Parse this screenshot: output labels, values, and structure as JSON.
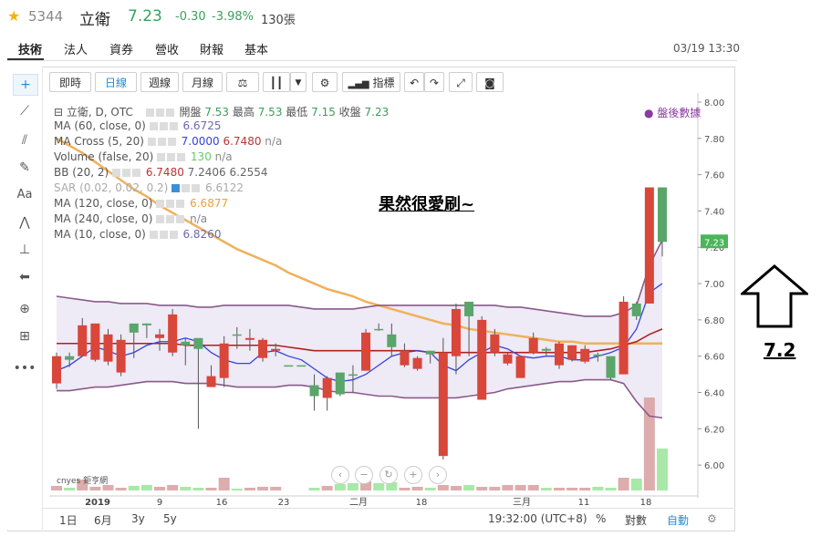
{
  "quote": {
    "star_icon": "star-icon",
    "code": "5344",
    "name": "立衛",
    "price": "7.23",
    "change": "-0.30",
    "change_pct": "-3.98%",
    "volume": "130張",
    "accent_up": "#d9534f",
    "accent_down": "#3a9f5a"
  },
  "tabs": [
    "技術",
    "法人",
    "資券",
    "營收",
    "財報",
    "基本"
  ],
  "timestamp": "03/19 13:30",
  "toolbar": {
    "buttons": [
      "即時",
      "日線",
      "週線",
      "月線"
    ],
    "active": "日線",
    "indicators_label": "指標"
  },
  "legend": {
    "main": "立衛, D, OTC",
    "ohlc_labels": [
      "開盤",
      "最高",
      "最低",
      "收盤"
    ],
    "ohlc_values": [
      "7.53",
      "7.53",
      "7.15",
      "7.23"
    ],
    "after_hours": "盤後數據",
    "rows": [
      {
        "name": "MA (60, close, 0)",
        "values": [
          "6.6725"
        ]
      },
      {
        "name": "MA Cross (5, 20)",
        "values": [
          "7.0000",
          "6.7480",
          "n/a"
        ]
      },
      {
        "name": "Volume (false, 20)",
        "values": [
          "130",
          "n/a"
        ]
      },
      {
        "name": "BB (20, 2)",
        "values": [
          "6.7480",
          "7.2406",
          "6.2554"
        ]
      },
      {
        "name": "SAR (0.02, 0.02, 0.2)",
        "values": [
          "6.6122"
        ]
      },
      {
        "name": "MA (120, close, 0)",
        "values": [
          "6.6877"
        ]
      },
      {
        "name": "MA (240, close, 0)",
        "values": [
          "n/a"
        ]
      },
      {
        "name": "MA (10, close, 0)",
        "values": [
          "6.8260"
        ]
      }
    ]
  },
  "annotation_text": "果然很愛刷~",
  "arrow_label": "7.2",
  "watermark": "cnyes 鉅亨網",
  "bottom": {
    "ranges": [
      "1日",
      "6月",
      "3y",
      "5y"
    ],
    "time": "19:32:00 (UTC+8)",
    "pct": "%",
    "log": "對數",
    "auto": "自動"
  },
  "chart_data": {
    "type": "candlestick",
    "y_ticks": [
      "8.00",
      "7.80",
      "7.60",
      "7.40",
      "7.20",
      "7.00",
      "6.80",
      "6.60",
      "6.40",
      "6.20",
      "6.00"
    ],
    "ylim": [
      5.85,
      8.02
    ],
    "last_price_label": "7.23",
    "x_ticks": [
      "2019",
      "9",
      "16",
      "23",
      "二月",
      "18",
      "三月",
      "11",
      "18"
    ],
    "candles": [
      {
        "o": 6.6,
        "h": 6.62,
        "l": 6.42,
        "c": 6.45
      },
      {
        "o": 6.58,
        "h": 6.62,
        "l": 6.54,
        "c": 6.6
      },
      {
        "o": 6.77,
        "h": 6.81,
        "l": 6.6,
        "c": 6.6
      },
      {
        "o": 6.78,
        "h": 6.78,
        "l": 6.57,
        "c": 6.58
      },
      {
        "o": 6.72,
        "h": 6.75,
        "l": 6.55,
        "c": 6.57
      },
      {
        "o": 6.69,
        "h": 6.72,
        "l": 6.49,
        "c": 6.51
      },
      {
        "o": 6.73,
        "h": 6.77,
        "l": 6.59,
        "c": 6.78
      },
      {
        "o": 6.77,
        "h": 6.78,
        "l": 6.7,
        "c": 6.78
      },
      {
        "o": 6.72,
        "h": 6.75,
        "l": 6.63,
        "c": 6.7
      },
      {
        "o": 6.83,
        "h": 6.86,
        "l": 6.6,
        "c": 6.62
      },
      {
        "o": 6.66,
        "h": 6.7,
        "l": 6.55,
        "c": 6.68
      },
      {
        "o": 6.64,
        "h": 6.68,
        "l": 6.2,
        "c": 6.7
      },
      {
        "o": 6.49,
        "h": 6.55,
        "l": 6.43,
        "c": 6.43
      },
      {
        "o": 6.67,
        "h": 6.71,
        "l": 6.43,
        "c": 6.48
      },
      {
        "o": 6.72,
        "h": 6.76,
        "l": 6.64,
        "c": 6.72
      },
      {
        "o": 6.7,
        "h": 6.75,
        "l": 6.63,
        "c": 6.69
      },
      {
        "o": 6.69,
        "h": 6.7,
        "l": 6.57,
        "c": 6.59
      },
      {
        "o": 6.64,
        "h": 6.67,
        "l": 6.6,
        "c": 6.63
      },
      {
        "o": 6.55,
        "h": 6.55,
        "l": 6.55,
        "c": 6.55
      },
      {
        "o": 6.55,
        "h": 6.55,
        "l": 6.55,
        "c": 6.55
      },
      {
        "o": 6.38,
        "h": 6.5,
        "l": 6.3,
        "c": 6.44
      },
      {
        "o": 6.48,
        "h": 6.49,
        "l": 6.3,
        "c": 6.37
      },
      {
        "o": 6.39,
        "h": 6.5,
        "l": 6.38,
        "c": 6.51
      },
      {
        "o": 6.5,
        "h": 6.55,
        "l": 6.4,
        "c": 6.5
      },
      {
        "o": 6.73,
        "h": 6.75,
        "l": 6.52,
        "c": 6.52
      },
      {
        "o": 6.75,
        "h": 6.78,
        "l": 6.74,
        "c": 6.75
      },
      {
        "o": 6.65,
        "h": 6.78,
        "l": 6.6,
        "c": 6.72
      },
      {
        "o": 6.63,
        "h": 6.67,
        "l": 6.54,
        "c": 6.55
      },
      {
        "o": 6.59,
        "h": 6.6,
        "l": 6.52,
        "c": 6.53
      },
      {
        "o": 6.61,
        "h": 6.63,
        "l": 6.56,
        "c": 6.63
      },
      {
        "o": 6.62,
        "h": 6.7,
        "l": 6.03,
        "c": 6.05
      },
      {
        "o": 6.86,
        "h": 6.89,
        "l": 6.5,
        "c": 6.6
      },
      {
        "o": 6.82,
        "h": 6.9,
        "l": 6.6,
        "c": 6.9
      },
      {
        "o": 6.8,
        "h": 6.82,
        "l": 6.36,
        "c": 6.36
      },
      {
        "o": 6.72,
        "h": 6.75,
        "l": 6.6,
        "c": 6.62
      },
      {
        "o": 6.61,
        "h": 6.62,
        "l": 6.55,
        "c": 6.56
      },
      {
        "o": 6.6,
        "h": 6.6,
        "l": 6.48,
        "c": 6.48
      },
      {
        "o": 6.7,
        "h": 6.73,
        "l": 6.61,
        "c": 6.62
      },
      {
        "o": 6.63,
        "h": 6.65,
        "l": 6.6,
        "c": 6.64
      },
      {
        "o": 6.67,
        "h": 6.68,
        "l": 6.53,
        "c": 6.55
      },
      {
        "o": 6.66,
        "h": 6.66,
        "l": 6.57,
        "c": 6.58
      },
      {
        "o": 6.64,
        "h": 6.66,
        "l": 6.56,
        "c": 6.57
      },
      {
        "o": 6.6,
        "h": 6.62,
        "l": 6.57,
        "c": 6.61
      },
      {
        "o": 6.48,
        "h": 6.52,
        "l": 6.47,
        "c": 6.6
      },
      {
        "o": 6.9,
        "h": 6.93,
        "l": 6.5,
        "c": 6.5
      },
      {
        "o": 6.82,
        "h": 6.9,
        "l": 6.8,
        "c": 6.89
      },
      {
        "o": 7.53,
        "h": 7.53,
        "l": 6.89,
        "c": 6.89
      },
      {
        "o": 7.23,
        "h": 7.53,
        "l": 7.15,
        "c": 7.53
      }
    ],
    "volume": [
      0.5,
      0.3,
      1.2,
      0.4,
      0.6,
      0.3,
      0.5,
      0.6,
      0.4,
      0.6,
      0.4,
      0.3,
      0.3,
      1.4,
      0.2,
      0.3,
      0.4,
      0.4,
      0,
      0,
      0.3,
      0.5,
      0.7,
      0.8,
      1.0,
      0.8,
      0.9,
      0.3,
      0.4,
      0.3,
      0.6,
      0.5,
      0.6,
      0.4,
      0.4,
      0.6,
      0.6,
      0.6,
      0.3,
      0.3,
      0.3,
      0.3,
      0.4,
      0.3,
      1.4,
      1.3,
      10.2,
      4.6
    ],
    "bb_upper": [
      6.93,
      6.92,
      6.91,
      6.9,
      6.9,
      6.89,
      6.89,
      6.89,
      6.88,
      6.88,
      6.88,
      6.87,
      6.87,
      6.88,
      6.88,
      6.88,
      6.88,
      6.88,
      6.88,
      6.87,
      6.86,
      6.86,
      6.86,
      6.86,
      6.87,
      6.88,
      6.88,
      6.88,
      6.88,
      6.88,
      6.88,
      6.88,
      6.88,
      6.88,
      6.88,
      6.87,
      6.87,
      6.86,
      6.85,
      6.84,
      6.83,
      6.82,
      6.82,
      6.82,
      6.84,
      6.88,
      7.1,
      7.24
    ],
    "bb_lower": [
      6.41,
      6.41,
      6.42,
      6.43,
      6.43,
      6.44,
      6.45,
      6.46,
      6.46,
      6.46,
      6.45,
      6.45,
      6.45,
      6.44,
      6.43,
      6.43,
      6.43,
      6.43,
      6.44,
      6.44,
      6.43,
      6.41,
      6.4,
      6.4,
      6.39,
      6.38,
      6.38,
      6.37,
      6.37,
      6.37,
      6.37,
      6.37,
      6.38,
      6.39,
      6.4,
      6.42,
      6.43,
      6.44,
      6.45,
      6.46,
      6.46,
      6.47,
      6.47,
      6.47,
      6.45,
      6.35,
      6.27,
      6.26
    ],
    "bb_mid": [
      6.67,
      6.67,
      6.67,
      6.67,
      6.67,
      6.67,
      6.67,
      6.67,
      6.67,
      6.67,
      6.66,
      6.66,
      6.66,
      6.66,
      6.66,
      6.66,
      6.66,
      6.66,
      6.65,
      6.64,
      6.63,
      6.63,
      6.63,
      6.63,
      6.63,
      6.63,
      6.63,
      6.63,
      6.63,
      6.62,
      6.62,
      6.62,
      6.62,
      6.62,
      6.62,
      6.62,
      6.62,
      6.62,
      6.62,
      6.62,
      6.62,
      6.62,
      6.63,
      6.64,
      6.66,
      6.68,
      6.72,
      6.75
    ],
    "ma5": [
      6.52,
      6.55,
      6.6,
      6.65,
      6.63,
      6.6,
      6.62,
      6.66,
      6.68,
      6.68,
      6.7,
      6.68,
      6.62,
      6.58,
      6.56,
      6.56,
      6.62,
      6.63,
      6.6,
      6.58,
      6.53,
      6.48,
      6.46,
      6.47,
      6.5,
      6.55,
      6.6,
      6.62,
      6.63,
      6.62,
      6.55,
      6.52,
      6.58,
      6.62,
      6.66,
      6.64,
      6.6,
      6.59,
      6.6,
      6.6,
      6.58,
      6.58,
      6.6,
      6.62,
      6.65,
      6.75,
      6.95,
      7.0
    ],
    "ma60": [
      7.8,
      7.76,
      7.72,
      7.67,
      7.62,
      7.57,
      7.52,
      7.48,
      7.43,
      7.39,
      7.35,
      7.31,
      7.27,
      7.23,
      7.19,
      7.16,
      7.13,
      7.1,
      7.06,
      7.03,
      7.0,
      6.97,
      6.95,
      6.93,
      6.9,
      6.88,
      6.86,
      6.84,
      6.82,
      6.8,
      6.78,
      6.77,
      6.75,
      6.74,
      6.73,
      6.72,
      6.71,
      6.7,
      6.69,
      6.68,
      6.68,
      6.67,
      6.67,
      6.67,
      6.67,
      6.67,
      6.67,
      6.67
    ]
  }
}
